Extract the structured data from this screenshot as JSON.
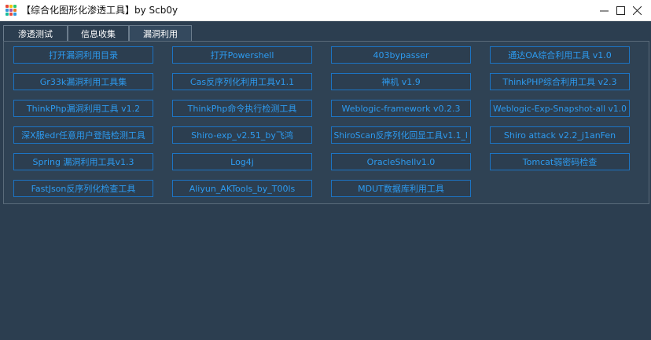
{
  "window": {
    "title": "【综合化图形化渗透工具】by Scb0y",
    "controls": {
      "minimize": "—",
      "maximize": "☐",
      "close": "✕"
    }
  },
  "tabs": [
    {
      "label": "渗透测试",
      "active": false
    },
    {
      "label": "信息收集",
      "active": false
    },
    {
      "label": "漏洞利用",
      "active": true
    }
  ],
  "tools": [
    [
      "打开漏洞利用目录",
      "打开Powershell",
      "403bypasser",
      "通达OA综合利用工具 v1.0"
    ],
    [
      "Gr33k漏洞利用工具集",
      "Cas反序列化利用工具v1.1",
      "神机 v1.9",
      "ThinkPHP综合利用工具 v2.3"
    ],
    [
      "ThinkPhp漏洞利用工具 v1.2",
      "ThinkPhp命令执行检测工具",
      "Weblogic-framework v0.2.3",
      "Weblogic-Exp-Snapshot-all v1.0"
    ],
    [
      "深X服edr任意用户登陆检测工具",
      "Shiro-exp_v2.51_by飞鸿",
      "ShiroScan反序列化回显工具v1.1_l",
      "Shiro attack v2.2_j1anFen"
    ],
    [
      "Spring 漏洞利用工具v1.3",
      "Log4j",
      "OracleShellv1.0",
      "Tomcat弱密码检查"
    ],
    [
      "FastJson反序列化检查工具",
      "Aliyun_AKTools_by_T00ls",
      "MDUT数据库利用工具"
    ]
  ],
  "colors": {
    "background": "#2c3e50",
    "button_border": "#1c74c4",
    "button_text": "#2d9bf0"
  }
}
